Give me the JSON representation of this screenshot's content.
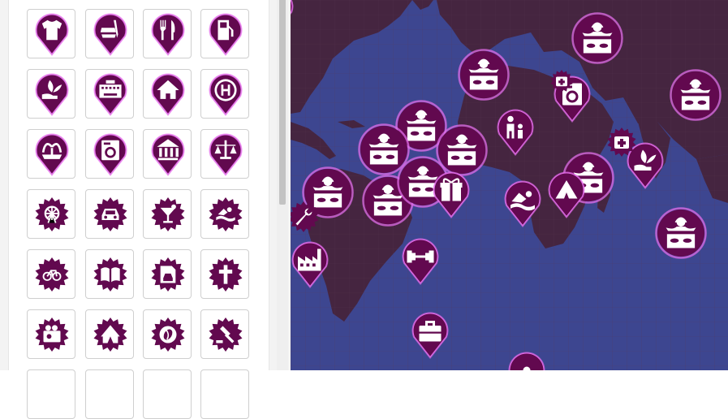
{
  "palette": {
    "accent": "#62094f",
    "glow": "#e26ce8",
    "ocean": "#3d4690",
    "land": "#452540",
    "label": "marker icons"
  },
  "sidebar": {
    "rows": [
      {
        "shape": "pin",
        "icons": [
          "tshirt-icon",
          "fast-food-icon",
          "restaurant-icon",
          "fuel-station-icon"
        ]
      },
      {
        "shape": "pin",
        "icons": [
          "plant-care-icon",
          "keyboard-icon",
          "home-icon",
          "hospital-icon"
        ]
      },
      {
        "shape": "pin",
        "icons": [
          "fountain-icon",
          "washing-machine-icon",
          "museum-icon",
          "courthouse-icon"
        ]
      },
      {
        "shape": "star",
        "icons": [
          "ferris-wheel-icon",
          "car-icon",
          "cocktail-icon",
          "swimming-pool-icon"
        ]
      },
      {
        "shape": "star",
        "icons": [
          "bicycle-icon",
          "open-book-icon",
          "car-rental-icon",
          "church-cross-icon"
        ]
      },
      {
        "shape": "star",
        "icons": [
          "movie-rental-icon",
          "circus-tent-icon",
          "coffee-icon",
          "auction-gavel-icon"
        ]
      }
    ]
  },
  "map": {
    "markers": [
      {
        "name": "map-marker-dj",
        "icon": "dj-icon",
        "shape": "circle"
      },
      {
        "name": "map-marker-dj",
        "icon": "dj-icon",
        "shape": "circle"
      },
      {
        "name": "map-marker-dj",
        "icon": "dj-icon",
        "shape": "circle"
      },
      {
        "name": "map-marker-dj",
        "icon": "dj-icon",
        "shape": "circle"
      },
      {
        "name": "map-marker-dj",
        "icon": "dj-icon",
        "shape": "circle"
      },
      {
        "name": "map-marker-dj",
        "icon": "dj-icon",
        "shape": "circle"
      },
      {
        "name": "map-marker-dj",
        "icon": "dj-icon",
        "shape": "circle"
      },
      {
        "name": "map-marker-dj",
        "icon": "dj-icon",
        "shape": "circle"
      },
      {
        "name": "map-marker-dj",
        "icon": "dj-icon",
        "shape": "circle"
      },
      {
        "name": "map-marker-dj",
        "icon": "dj-icon",
        "shape": "circle"
      },
      {
        "name": "map-marker-dj",
        "icon": "dj-icon",
        "shape": "circle"
      },
      {
        "name": "map-marker-laundry",
        "icon": "washing-machine-icon",
        "shape": "pin"
      },
      {
        "name": "map-marker-family",
        "icon": "family-icon",
        "shape": "pin"
      },
      {
        "name": "map-marker-gift",
        "icon": "gift-icon",
        "shape": "pin"
      },
      {
        "name": "map-marker-swimming",
        "icon": "swimmer-icon",
        "shape": "pin"
      },
      {
        "name": "map-marker-tent",
        "icon": "tent-icon",
        "shape": "pin"
      },
      {
        "name": "map-marker-plant",
        "icon": "plant-care-icon",
        "shape": "pin"
      },
      {
        "name": "map-marker-first-aid",
        "icon": "first-aid-icon",
        "shape": "star"
      },
      {
        "name": "map-marker-repair",
        "icon": "wrench-icon",
        "shape": "star"
      },
      {
        "name": "map-marker-factory",
        "icon": "factory-icon",
        "shape": "pin"
      },
      {
        "name": "map-marker-gym",
        "icon": "dumbbell-icon",
        "shape": "pin"
      },
      {
        "name": "map-marker-business",
        "icon": "briefcase-icon",
        "shape": "pin"
      },
      {
        "name": "map-marker-partial",
        "icon": "marker-icon",
        "shape": "pin"
      }
    ]
  }
}
